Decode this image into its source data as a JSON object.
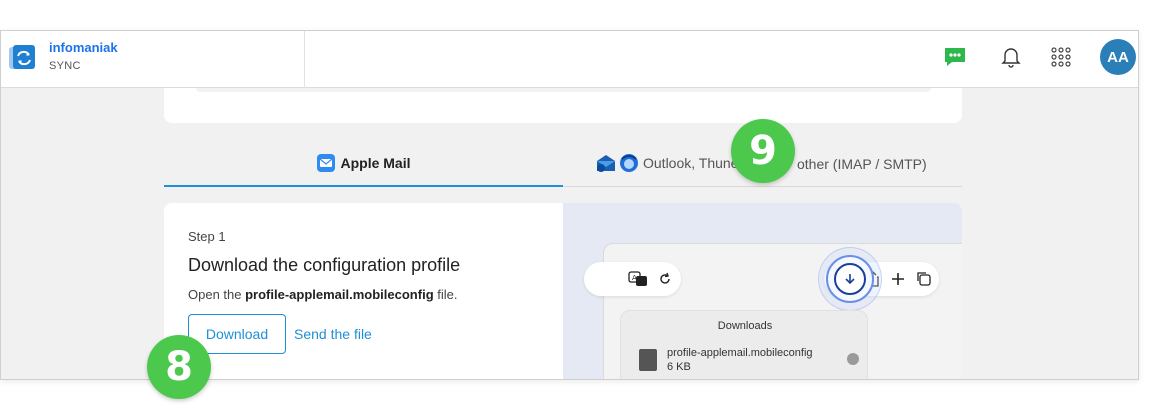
{
  "brand": {
    "name": "infomaniak",
    "subtitle": "SYNC"
  },
  "header": {
    "icons": [
      "chat-icon",
      "bell-icon",
      "apps-grid-icon"
    ],
    "avatar_initials": "AA",
    "colors": {
      "chat": "#2db84b",
      "avatar": "#2a7fb8"
    }
  },
  "tabs": [
    {
      "label": "Apple Mail",
      "active": true
    },
    {
      "label_part1": "Outlook, Thune",
      "label_part2": "other (IMAP / SMTP)",
      "active": false
    }
  ],
  "step": {
    "label": "Step 1",
    "title": "Download the configuration profile",
    "desc_prefix": "Open the ",
    "desc_file": "profile-applemail.mobileconfig",
    "desc_suffix": " file.",
    "download_label": "Download",
    "send_label": "Send the file"
  },
  "illustration": {
    "panel_title": "Downloads",
    "file_name": "profile-applemail.mobileconfig",
    "file_size": "6 KB"
  },
  "badges": {
    "a": "9",
    "b": "8"
  },
  "colors": {
    "accent": "#1f8fd6",
    "badge": "#4cc94c"
  }
}
